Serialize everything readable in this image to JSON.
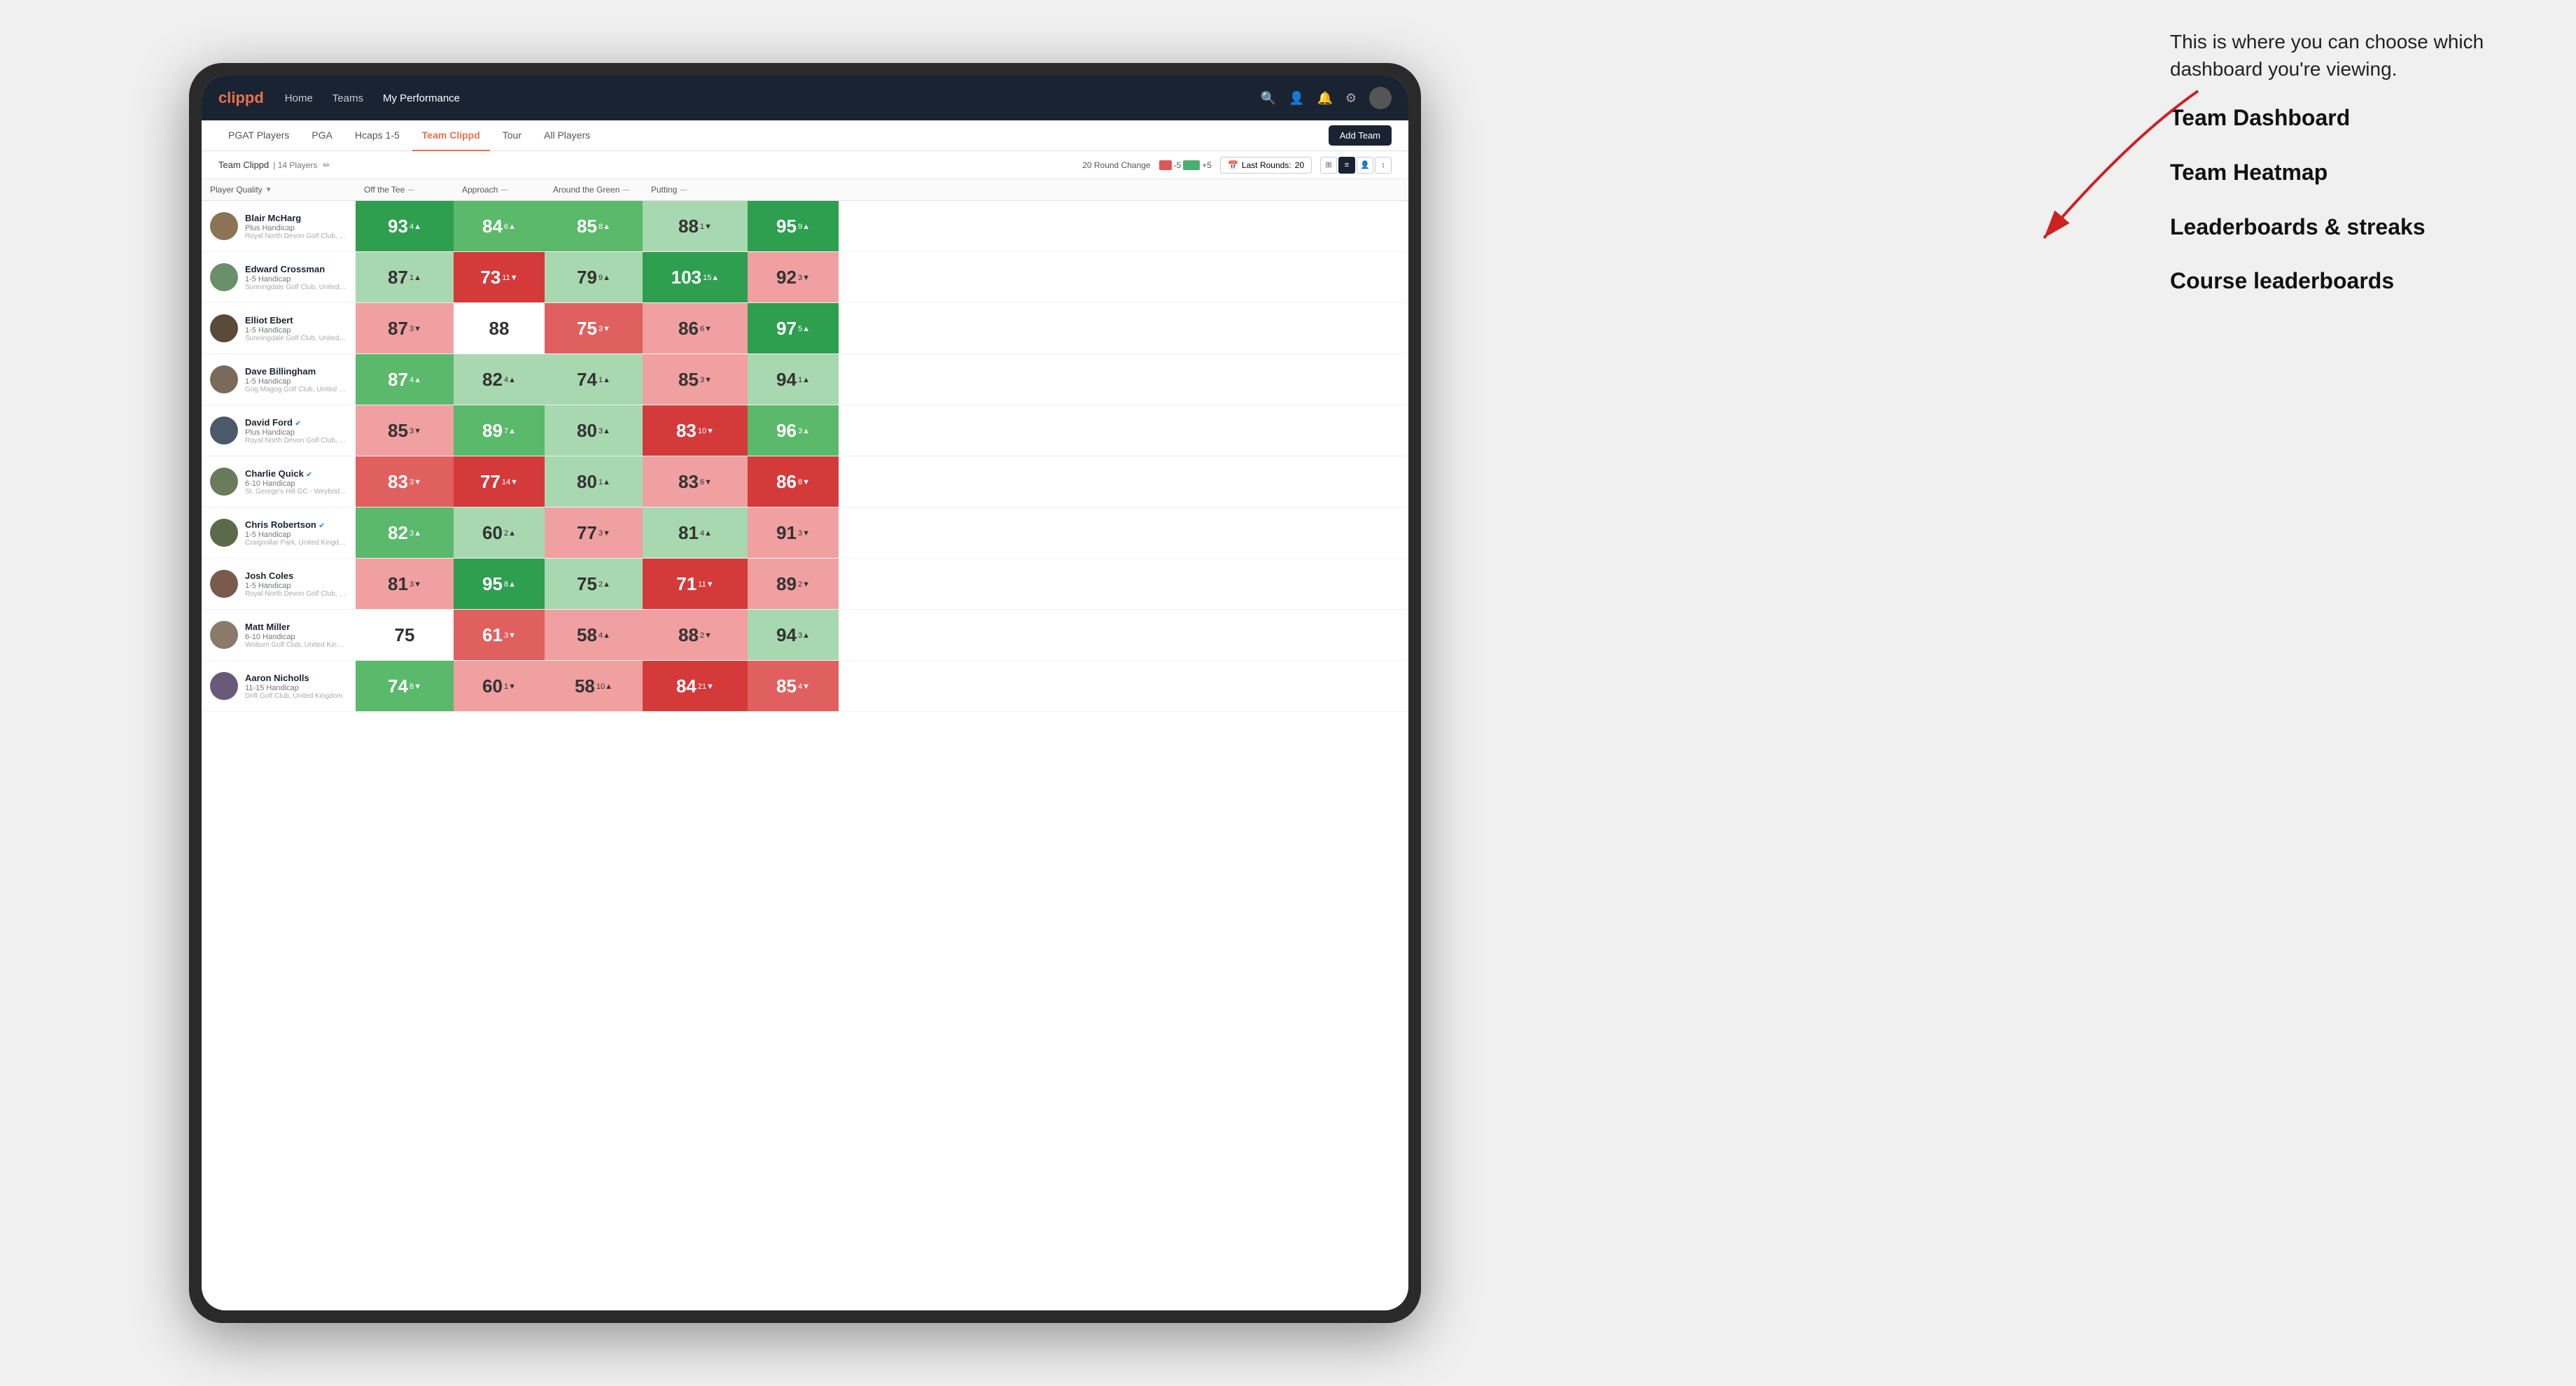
{
  "annotation": {
    "intro": "This is where you can choose which dashboard you're viewing.",
    "items": [
      "Team Dashboard",
      "Team Heatmap",
      "Leaderboards & streaks",
      "Course leaderboards"
    ]
  },
  "nav": {
    "logo": "clippd",
    "links": [
      "Home",
      "Teams",
      "My Performance"
    ],
    "active_link": "My Performance"
  },
  "tabs": {
    "items": [
      "PGAT Players",
      "PGA",
      "Hcaps 1-5",
      "Team Clippd",
      "Tour",
      "All Players"
    ],
    "active": "Team Clippd",
    "add_button": "Add Team"
  },
  "subbar": {
    "team_name": "Team Clippd",
    "player_count": "14 Players",
    "round_change_label": "20 Round Change",
    "round_change_neg": "-5",
    "round_change_pos": "+5",
    "last_rounds_label": "Last Rounds:",
    "last_rounds_val": "20"
  },
  "columns": [
    {
      "id": "player",
      "label": "Player Quality",
      "arrow": "▼"
    },
    {
      "id": "tee",
      "label": "Off the Tee",
      "arrow": "—"
    },
    {
      "id": "approach",
      "label": "Approach",
      "arrow": "—"
    },
    {
      "id": "around",
      "label": "Around the Green",
      "arrow": "—"
    },
    {
      "id": "putting",
      "label": "Putting",
      "arrow": "—"
    }
  ],
  "players": [
    {
      "name": "Blair McHarg",
      "handicap": "Plus Handicap",
      "club": "Royal North Devon Golf Club, United Kingdom",
      "verified": false,
      "avatar_color": "#8B7355",
      "scores": [
        {
          "val": 93,
          "change": "4",
          "dir": "up",
          "bg": "green-dark"
        },
        {
          "val": 84,
          "change": "6",
          "dir": "up",
          "bg": "green-mid"
        },
        {
          "val": 85,
          "change": "8",
          "dir": "up",
          "bg": "green-mid"
        },
        {
          "val": 88,
          "change": "1",
          "dir": "down",
          "bg": "green-light"
        },
        {
          "val": 95,
          "change": "9",
          "dir": "up",
          "bg": "green-dark"
        }
      ]
    },
    {
      "name": "Edward Crossman",
      "handicap": "1-5 Handicap",
      "club": "Sunningdale Golf Club, United Kingdom",
      "verified": false,
      "avatar_color": "#6B8E6B",
      "scores": [
        {
          "val": 87,
          "change": "1",
          "dir": "up",
          "bg": "green-light"
        },
        {
          "val": 73,
          "change": "11",
          "dir": "down",
          "bg": "red-dark"
        },
        {
          "val": 79,
          "change": "9",
          "dir": "up",
          "bg": "green-light"
        },
        {
          "val": 103,
          "change": "15",
          "dir": "up",
          "bg": "green-dark"
        },
        {
          "val": 92,
          "change": "3",
          "dir": "down",
          "bg": "red-light"
        }
      ]
    },
    {
      "name": "Elliot Ebert",
      "handicap": "1-5 Handicap",
      "club": "Sunningdale Golf Club, United Kingdom",
      "verified": false,
      "avatar_color": "#5a4a3a",
      "scores": [
        {
          "val": 87,
          "change": "3",
          "dir": "down",
          "bg": "red-light"
        },
        {
          "val": 88,
          "change": "",
          "dir": "",
          "bg": "white"
        },
        {
          "val": 75,
          "change": "3",
          "dir": "down",
          "bg": "red-mid"
        },
        {
          "val": 86,
          "change": "6",
          "dir": "down",
          "bg": "red-light"
        },
        {
          "val": 97,
          "change": "5",
          "dir": "up",
          "bg": "green-dark"
        }
      ]
    },
    {
      "name": "Dave Billingham",
      "handicap": "1-5 Handicap",
      "club": "Gog Magog Golf Club, United Kingdom",
      "verified": false,
      "avatar_color": "#7a6a5a",
      "scores": [
        {
          "val": 87,
          "change": "4",
          "dir": "up",
          "bg": "green-mid"
        },
        {
          "val": 82,
          "change": "4",
          "dir": "up",
          "bg": "green-light"
        },
        {
          "val": 74,
          "change": "1",
          "dir": "up",
          "bg": "green-light"
        },
        {
          "val": 85,
          "change": "3",
          "dir": "down",
          "bg": "red-light"
        },
        {
          "val": 94,
          "change": "1",
          "dir": "up",
          "bg": "green-light"
        }
      ]
    },
    {
      "name": "David Ford",
      "handicap": "Plus Handicap",
      "club": "Royal North Devon Golf Club, United Kingdom",
      "verified": true,
      "avatar_color": "#4a5a6a",
      "scores": [
        {
          "val": 85,
          "change": "3",
          "dir": "down",
          "bg": "red-light"
        },
        {
          "val": 89,
          "change": "7",
          "dir": "up",
          "bg": "green-mid"
        },
        {
          "val": 80,
          "change": "3",
          "dir": "up",
          "bg": "green-light"
        },
        {
          "val": 83,
          "change": "10",
          "dir": "down",
          "bg": "red-dark"
        },
        {
          "val": 96,
          "change": "3",
          "dir": "up",
          "bg": "green-mid"
        }
      ]
    },
    {
      "name": "Charlie Quick",
      "handicap": "6-10 Handicap",
      "club": "St. George's Hill GC - Weybridge - Surrey, Uni...",
      "verified": true,
      "avatar_color": "#6a7a5a",
      "scores": [
        {
          "val": 83,
          "change": "3",
          "dir": "down",
          "bg": "red-mid"
        },
        {
          "val": 77,
          "change": "14",
          "dir": "down",
          "bg": "red-dark"
        },
        {
          "val": 80,
          "change": "1",
          "dir": "up",
          "bg": "green-light"
        },
        {
          "val": 83,
          "change": "6",
          "dir": "down",
          "bg": "red-light"
        },
        {
          "val": 86,
          "change": "8",
          "dir": "down",
          "bg": "red-dark"
        }
      ]
    },
    {
      "name": "Chris Robertson",
      "handicap": "1-5 Handicap",
      "club": "Craigmillar Park, United Kingdom",
      "verified": true,
      "avatar_color": "#5a6a4a",
      "scores": [
        {
          "val": 82,
          "change": "3",
          "dir": "up",
          "bg": "green-mid"
        },
        {
          "val": 60,
          "change": "2",
          "dir": "up",
          "bg": "green-light"
        },
        {
          "val": 77,
          "change": "3",
          "dir": "down",
          "bg": "red-light"
        },
        {
          "val": 81,
          "change": "4",
          "dir": "up",
          "bg": "green-light"
        },
        {
          "val": 91,
          "change": "3",
          "dir": "down",
          "bg": "red-light"
        }
      ]
    },
    {
      "name": "Josh Coles",
      "handicap": "1-5 Handicap",
      "club": "Royal North Devon Golf Club, United Kingdom",
      "verified": false,
      "avatar_color": "#7a5a4a",
      "scores": [
        {
          "val": 81,
          "change": "3",
          "dir": "down",
          "bg": "red-light"
        },
        {
          "val": 95,
          "change": "8",
          "dir": "up",
          "bg": "green-dark"
        },
        {
          "val": 75,
          "change": "2",
          "dir": "up",
          "bg": "green-light"
        },
        {
          "val": 71,
          "change": "11",
          "dir": "down",
          "bg": "red-dark"
        },
        {
          "val": 89,
          "change": "2",
          "dir": "down",
          "bg": "red-light"
        }
      ]
    },
    {
      "name": "Matt Miller",
      "handicap": "6-10 Handicap",
      "club": "Woburn Golf Club, United Kingdom",
      "verified": false,
      "avatar_color": "#8a7a6a",
      "scores": [
        {
          "val": 75,
          "change": "",
          "dir": "",
          "bg": "white"
        },
        {
          "val": 61,
          "change": "3",
          "dir": "down",
          "bg": "red-mid"
        },
        {
          "val": 58,
          "change": "4",
          "dir": "up",
          "bg": "red-light"
        },
        {
          "val": 88,
          "change": "2",
          "dir": "down",
          "bg": "red-light"
        },
        {
          "val": 94,
          "change": "3",
          "dir": "up",
          "bg": "green-light"
        }
      ]
    },
    {
      "name": "Aaron Nicholls",
      "handicap": "11-15 Handicap",
      "club": "Drift Golf Club, United Kingdom",
      "verified": false,
      "avatar_color": "#6a5a7a",
      "scores": [
        {
          "val": 74,
          "change": "8",
          "dir": "down",
          "bg": "green-mid"
        },
        {
          "val": 60,
          "change": "1",
          "dir": "down",
          "bg": "red-light"
        },
        {
          "val": 58,
          "change": "10",
          "dir": "up",
          "bg": "red-light"
        },
        {
          "val": 84,
          "change": "21",
          "dir": "down",
          "bg": "red-dark"
        },
        {
          "val": 85,
          "change": "4",
          "dir": "down",
          "bg": "red-mid"
        }
      ]
    }
  ]
}
